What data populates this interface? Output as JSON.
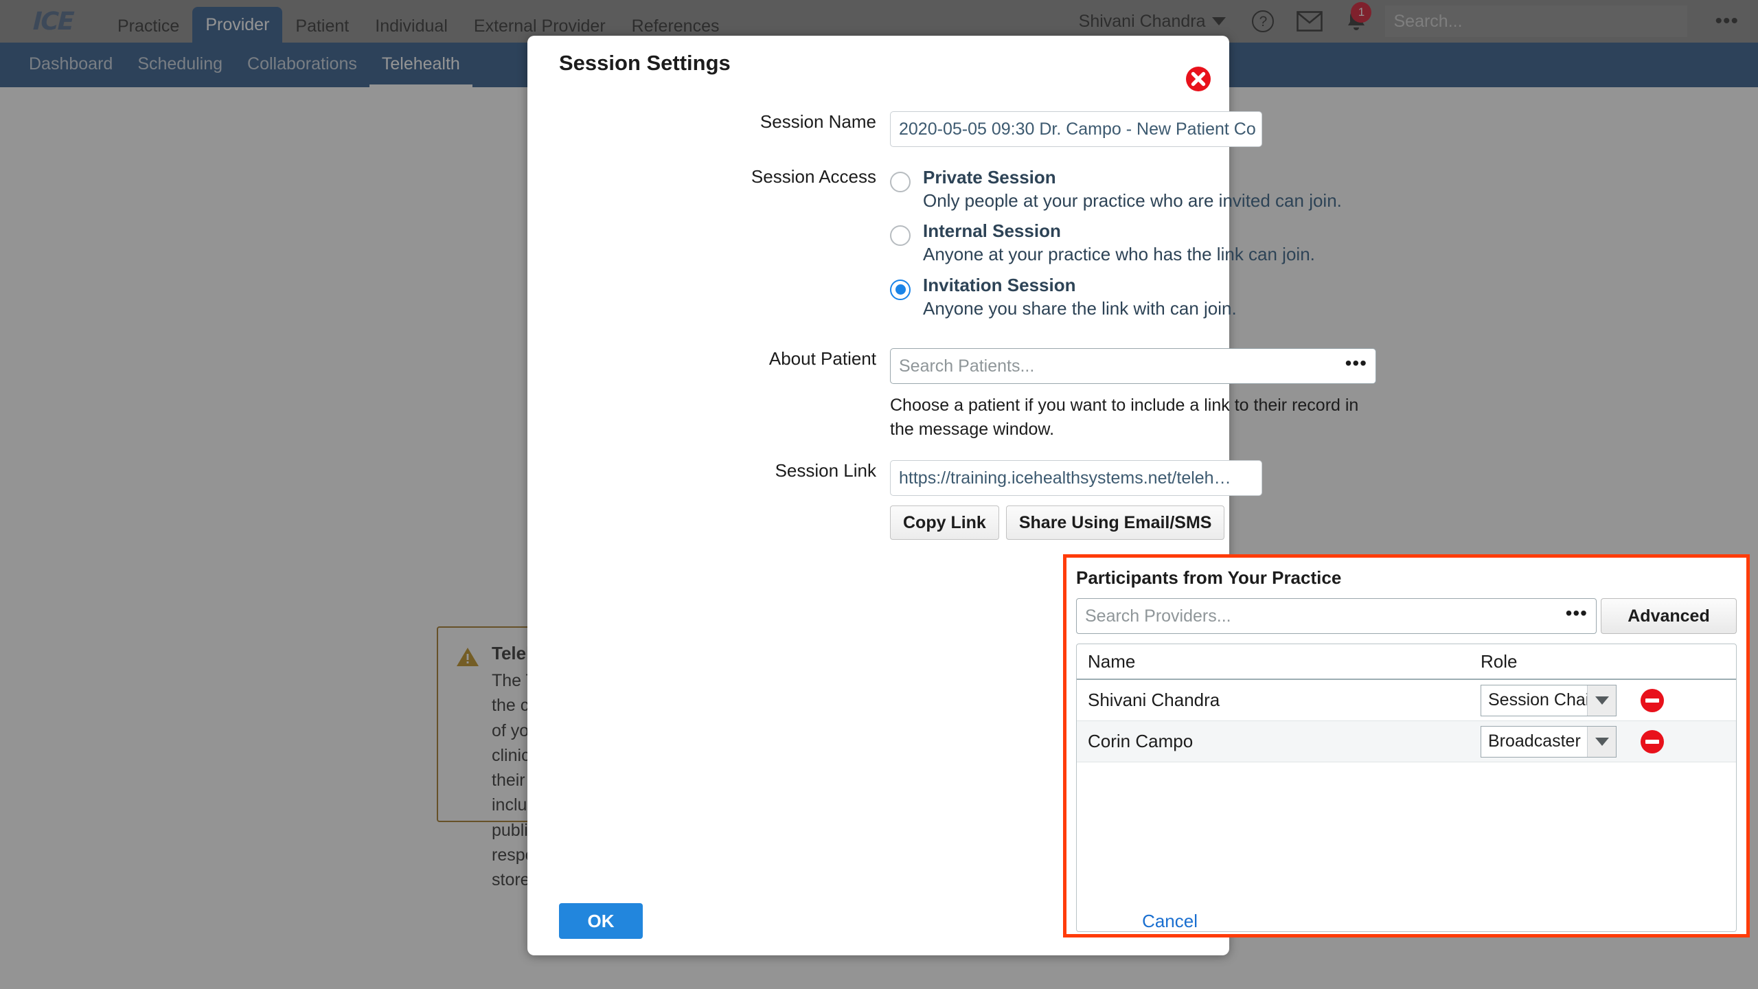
{
  "header": {
    "logo_text": "ICE",
    "nav_items": [
      {
        "label": "Practice",
        "active": false
      },
      {
        "label": "Provider",
        "active": true
      },
      {
        "label": "Patient",
        "active": false
      },
      {
        "label": "Individual",
        "active": false
      },
      {
        "label": "External Provider",
        "active": false
      },
      {
        "label": "References",
        "active": false
      }
    ],
    "user_name": "Shivani Chandra",
    "help_glyph": "?",
    "notification_count": "1",
    "search_placeholder": "Search...",
    "overflow_glyph": "•••"
  },
  "subnav": {
    "items": [
      {
        "label": "Dashboard",
        "active": false
      },
      {
        "label": "Scheduling",
        "active": false
      },
      {
        "label": "Collaborations",
        "active": false
      },
      {
        "label": "Telehealth",
        "active": true
      }
    ]
  },
  "background_notice": {
    "title": "Telehealth Disclaimer",
    "body": "The Telehealth service is provided as-is. The quality of the session depends on factors that are outside of the control of ICE Health Systems, including but not limited to the service provider, bandwidth and latency of your internet connection. ICE is not responsible for any results of a Telehealth session, including any clinical decisions or recommendations made during the session. Clients are responsible for ensuring that their use of the Telehealth service complies with all applicable laws, regulations and privacy requirements including ensuring that appropriate consent is obtained. Video streaming of sessions is performed over the public internet. As a result, ICE cannot guarantee its security. Any recordings of sessions are the responsibility of the session chair, and it is their responsibility to ensure that any recordings are properly stored and secured."
  },
  "dialog": {
    "title": "Session Settings",
    "close_glyph": "✕",
    "session_name": {
      "label": "Session Name",
      "value": "2020-05-05 09:30 Dr. Campo - New Patient Co"
    },
    "session_access": {
      "label": "Session Access",
      "options": [
        {
          "title": "Private Session",
          "description": "Only people at your practice who are invited can join.",
          "selected": false
        },
        {
          "title": "Internal Session",
          "description": "Anyone at your practice who has the link can join.",
          "selected": false
        },
        {
          "title": "Invitation Session",
          "description": "Anyone you share the link with can join.",
          "selected": true
        }
      ]
    },
    "about_patient": {
      "label": "About Patient",
      "placeholder": "Search Patients...",
      "value": "",
      "dots_glyph": "•••",
      "note": "Choose a patient if you want to include a link to their record in the message window."
    },
    "session_link": {
      "label": "Session Link",
      "value": "https://training.icehealthsystems.net/teleh…",
      "copy_label": "Copy Link",
      "share_label": "Share Using Email/SMS"
    },
    "participants": {
      "title": "Participants from Your Practice",
      "search_placeholder": "Search Providers...",
      "search_dots_glyph": "•••",
      "advanced_label": "Advanced",
      "columns": [
        "Name",
        "Role"
      ],
      "rows": [
        {
          "name": "Shivani Chandra",
          "role": "Session Chair"
        },
        {
          "name": "Corin Campo",
          "role": "Broadcaster"
        }
      ]
    },
    "footer": {
      "ok_label": "OK",
      "cancel_label": "Cancel"
    }
  },
  "colors": {
    "nav_bar": "#808080",
    "sub_nav": "#1b4a7e",
    "accent_blue": "#2286dd",
    "highlight_red": "#ff3c0a",
    "badge_red": "#d0021b",
    "warn_border": "#9a6a10"
  }
}
